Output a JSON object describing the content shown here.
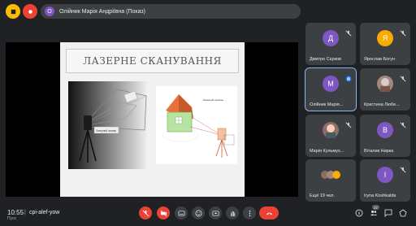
{
  "presenter": {
    "avatar_letter": "O",
    "label": "Олійник Марія Андріївна (Показ)"
  },
  "slide": {
    "title": "ЛАЗЕРНЕ СКАНУВАННЯ",
    "left_caption": "Лазерний сканер",
    "right_caption": "Лазерний промінь"
  },
  "participants": [
    {
      "letter": "Д",
      "name": "Дмитро Сєркoв",
      "color": "#7e57c2"
    },
    {
      "letter": "Я",
      "name": "Ярослав Богун",
      "color": "#f9ab00"
    },
    {
      "letter": "М",
      "name": "Олійник Марія...",
      "color": "#7e57c2"
    },
    {
      "letter": "",
      "name": "Кристина Любе...",
      "color": "#a1887f"
    },
    {
      "letter": "",
      "name": "Марія Кульмух...",
      "color": "#8d6e63"
    },
    {
      "letter": "В",
      "name": "Віталик Нирка",
      "color": "#7e57c2"
    },
    {
      "letter": "",
      "name": "Ещё 19 чел.",
      "color": "#5f6368"
    },
    {
      "letter": "І",
      "name": "Iryna Koshkalda",
      "color": "#7e57c2"
    }
  ],
  "bottom": {
    "time": "10:55",
    "time_sub": "Пуск",
    "separator": "|",
    "meeting_code": "cpi-alef-yow",
    "people_count": "27"
  },
  "colors": {
    "background": "#202124",
    "tile": "#3c4043",
    "danger": "#ea4335",
    "accent": "#8ab4f8"
  }
}
